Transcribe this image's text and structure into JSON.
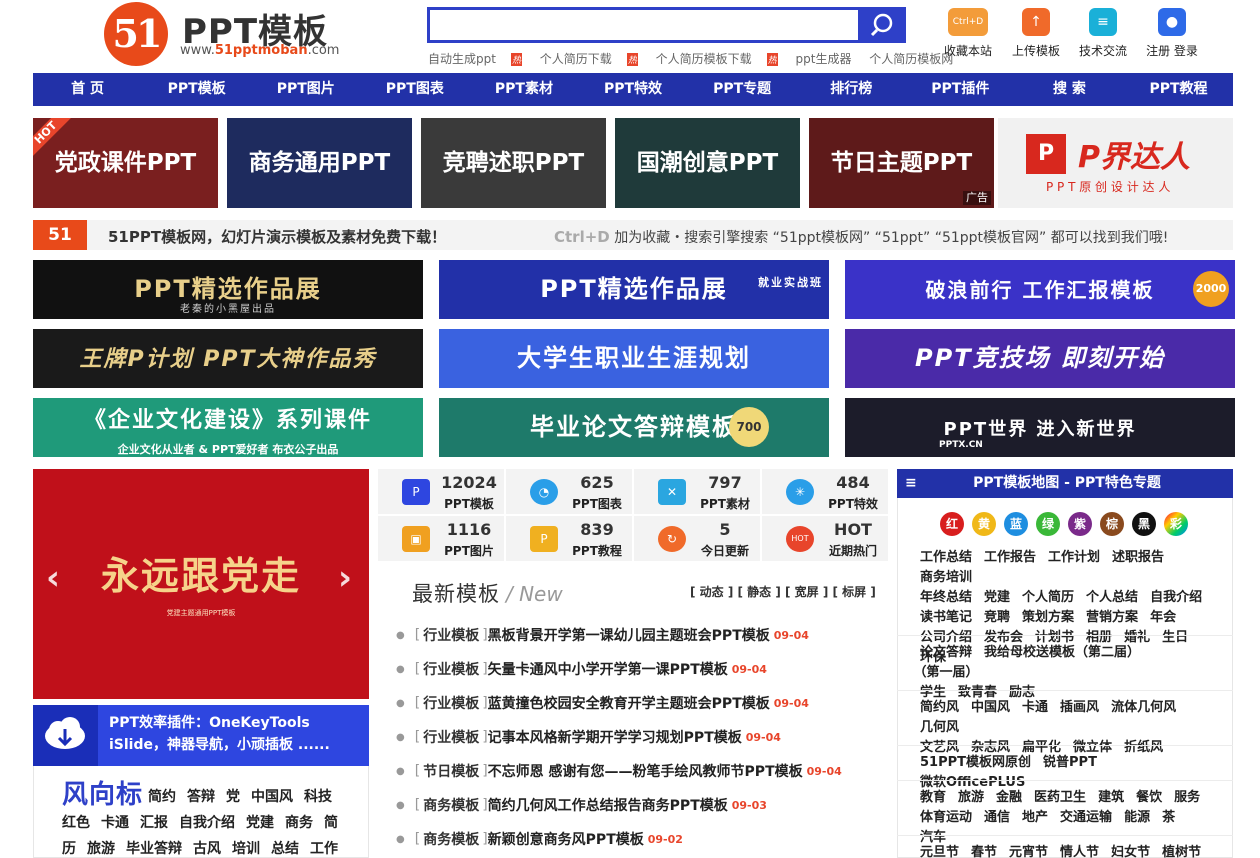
{
  "logo": {
    "mark": "51",
    "title": "PPT模板",
    "url_prefix": "www.",
    "url_brand": "51pptmoban",
    "url_suffix": ".com"
  },
  "search": {
    "placeholder": "",
    "hot_words": [
      "自动生成ppt",
      "个人简历下载",
      "个人简历模板下载",
      "ppt生成器",
      "个人简历模板网"
    ],
    "hot_badge": "热"
  },
  "tools": [
    {
      "label": "收藏本站",
      "icon": "Ctrl+D",
      "color": "#f39c3a"
    },
    {
      "label": "上传模板",
      "icon": "↑",
      "color": "#f06a2a"
    },
    {
      "label": "技术交流",
      "icon": "≡",
      "color": "#1ab0d8"
    },
    {
      "label": "注册 登录",
      "icon": "●",
      "color": "#2e6ae8"
    }
  ],
  "nav": [
    "首 页",
    "PPT模板",
    "PPT图片",
    "PPT图表",
    "PPT素材",
    "PPT特效",
    "PPT专题",
    "排行榜",
    "PPT插件",
    "搜 索",
    "PPT教程"
  ],
  "cats": [
    {
      "label": "党政课件PPT",
      "badge": "HOT",
      "bg": "#7a1f1f"
    },
    {
      "label": "商务通用PPT",
      "badge": "",
      "bg": "#1e2b5e"
    },
    {
      "label": "竞聘述职PPT",
      "badge": "",
      "bg": "#3a3a3a"
    },
    {
      "label": "国潮创意PPT",
      "badge": "",
      "bg": "#1f3a3a"
    },
    {
      "label": "节日主题PPT",
      "badge": "广告",
      "bg": "#5e1a1a"
    }
  ],
  "pjdr": {
    "title": "P界达人",
    "sub": "P P T 原 创 设 计 达 人"
  },
  "tagline": {
    "logo": "51",
    "left": "51PPT模板网，幻灯片演示模板及素材免费下载！",
    "right_key": "Ctrl+D",
    "right": "加为收藏・搜索引擎搜索 “51ppt模板网” “51ppt” “51ppt模板官网” 都可以找到我们哦!"
  },
  "promos": [
    {
      "label": "PPT精选作品展",
      "sub": "老秦的小黑屋出品",
      "bg": "#111111"
    },
    {
      "label": "PPT精选作品展",
      "sub": "就业实战班",
      "bg": "#2230a8"
    },
    {
      "label": "破浪前行  工作汇报模板",
      "sub": "2000",
      "bg": "#3a32c8"
    },
    {
      "label": "王牌P计划  PPT大神作品秀",
      "sub": "",
      "bg": "#1a1a1a"
    },
    {
      "label": "大学生职业生涯规划",
      "sub": "",
      "bg": "#3a62e0"
    },
    {
      "label": "PPT竞技场    即刻开始",
      "sub": "",
      "bg": "#4a2aa8"
    },
    {
      "label": "《企业文化建设》系列课件",
      "sub": "企业文化从业者 & PPT爱好者 布衣公子出品",
      "bg": "#1f9a7a"
    },
    {
      "label": "毕业论文答辩模板",
      "sub": "700",
      "bg": "#1e7a6a"
    },
    {
      "label": "PPT世界  进入新世界",
      "sub": "PPTX.CN",
      "bg": "#1c1c2a"
    }
  ],
  "slider": {
    "title": "永远跟党走",
    "sub": "党建主题通用PPT模板",
    "prev": "‹",
    "next": "›"
  },
  "plugin": {
    "line1": "PPT效率插件：OneKeyTools",
    "line2": "iSlide，神器导航，小顽插板 ......"
  },
  "styles": {
    "title": "风向标",
    "tags": [
      "简约",
      "答辩",
      "党",
      "中国风",
      "科技",
      "红色",
      "卡通",
      "汇报",
      "自我介绍",
      "党建",
      "商务",
      "简历",
      "旅游",
      "毕业答辩",
      "古风",
      "培训",
      "总结",
      "工作"
    ]
  },
  "stats": [
    {
      "num": "12024",
      "label": "PPT模板",
      "icon": "P",
      "color": "#2e46e0"
    },
    {
      "num": "625",
      "label": "PPT图表",
      "icon": "◔",
      "color": "#2a9ee8"
    },
    {
      "num": "797",
      "label": "PPT素材",
      "icon": "✕",
      "color": "#2aa6e0"
    },
    {
      "num": "484",
      "label": "PPT特效",
      "icon": "✳",
      "color": "#2a9ee8"
    },
    {
      "num": "1116",
      "label": "PPT图片",
      "icon": "▣",
      "color": "#f0a020"
    },
    {
      "num": "839",
      "label": "PPT教程",
      "icon": "P",
      "color": "#f0b020"
    },
    {
      "num": "5",
      "label": "今日更新",
      "icon": "↻",
      "color": "#f06a2a"
    },
    {
      "num": "HOT",
      "label": "近期热门",
      "icon": "HOT",
      "color": "#e8452b"
    }
  ],
  "latest": {
    "title": "最新模板",
    "new": "/ New",
    "filters": "[ 动态 ] [ 静态 ] [ 宽屏 ] [ 标屏 ]",
    "items": [
      {
        "cat": "行业模板",
        "title": "黑板背景开学第一课幼儿园主题班会PPT模板",
        "date": "09-04"
      },
      {
        "cat": "行业模板",
        "title": "矢量卡通风中小学开学第一课PPT模板",
        "date": "09-04"
      },
      {
        "cat": "行业模板",
        "title": "蓝黄撞色校园安全教育开学主题班会PPT模板",
        "date": "09-04"
      },
      {
        "cat": "行业模板",
        "title": "记事本风格新学期开学学习规划PPT模板",
        "date": "09-04"
      },
      {
        "cat": "节日模板",
        "title": "不忘师恩 感谢有您——粉笔手绘风教师节PPT模板",
        "date": "09-04"
      },
      {
        "cat": "商务模板",
        "title": "简约几何风工作总结报告商务PPT模板",
        "date": "09-03"
      },
      {
        "cat": "商务模板",
        "title": "新颖创意商务风PPT模板",
        "date": "09-02"
      }
    ]
  },
  "map": {
    "title": "PPT模板地图 - PPT特色专题",
    "colors": [
      {
        "label": "红",
        "color": "#d81e1e"
      },
      {
        "label": "黄",
        "color": "#f0b818"
      },
      {
        "label": "蓝",
        "color": "#1e8ee0"
      },
      {
        "label": "绿",
        "color": "#3ab838"
      },
      {
        "label": "紫",
        "color": "#7a2a8a"
      },
      {
        "label": "棕",
        "color": "#8a4a1e"
      },
      {
        "label": "黑",
        "color": "#111111"
      },
      {
        "label": "彩",
        "color": "#c83ab8"
      }
    ],
    "groups": [
      [
        "工作总结",
        "工作报告",
        "工作计划",
        "述职报告",
        "商务培训",
        "年终总结",
        "党建",
        "个人简历",
        "个人总结",
        "自我介绍",
        "读书笔记",
        "竞聘",
        "策划方案",
        "营销方案",
        "年会",
        "公司介绍",
        "发布会",
        "计划书",
        "相册",
        "婚礼",
        "生日",
        "环保"
      ],
      [
        "论文答辩",
        "我给母校送模板（第二届）",
        "（第一届）",
        "学生",
        "致青春",
        "励志"
      ],
      [
        "简约风",
        "中国风",
        "卡通",
        "插画风",
        "流体几何风",
        "几何风",
        "文艺风",
        "杂志风",
        "扁平化",
        "微立体",
        "折纸风"
      ],
      [
        "51PPT模板网原创",
        "锐普PPT",
        "微软OfficePLUS"
      ],
      [
        "教育",
        "旅游",
        "金融",
        "医药卫生",
        "建筑",
        "餐饮",
        "服务",
        "体育运动",
        "通信",
        "地产",
        "交通运输",
        "能源",
        "茶",
        "汽车"
      ],
      [
        "元旦节",
        "春节",
        "元宵节",
        "情人节",
        "妇女节",
        "植树节"
      ]
    ]
  }
}
